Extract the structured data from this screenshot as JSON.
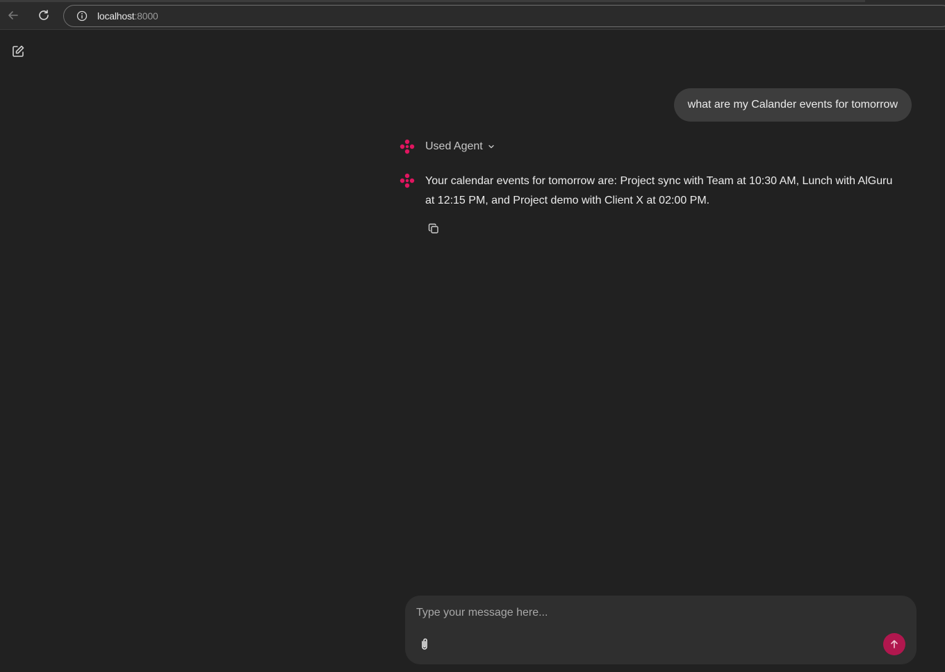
{
  "browser": {
    "url_host": "localhost",
    "url_port": ":8000"
  },
  "chat": {
    "user_message": "what are my Calander events for tomorrow",
    "agent_toggle_label": "Used Agent",
    "assistant_reply": "Your calendar events for tomorrow are: Project sync with Team at 10:30 AM, Lunch with AlGuru at 12:15 PM, and Project demo with Client X at 02:00 PM."
  },
  "composer": {
    "placeholder": "Type your message here...",
    "value": ""
  },
  "colors": {
    "background": "#212121",
    "accent": "#e0155f",
    "send_button": "#b0174e",
    "user_bubble": "#3d3d3d",
    "composer": "#2f2f2f"
  }
}
